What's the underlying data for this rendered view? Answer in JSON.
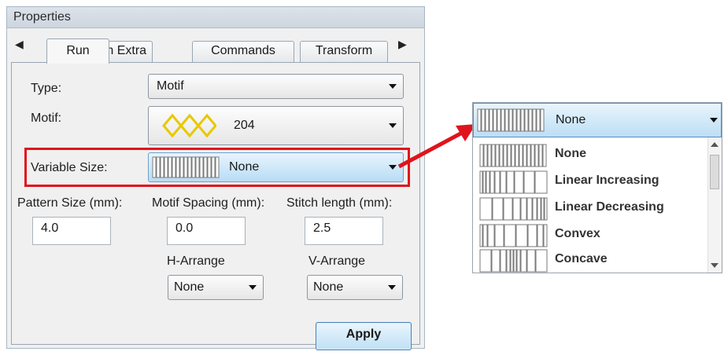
{
  "panel": {
    "title": "Properties",
    "tabs": [
      "Run",
      "Run Extra",
      "Commands",
      "Transform"
    ],
    "active_tab": "Run"
  },
  "fields": {
    "type_label": "Type:",
    "type_value": "Motif",
    "motif_label": "Motif:",
    "motif_value": "204",
    "variable_size_label": "Variable Size:",
    "variable_size_value": "None",
    "pattern_size_label": "Pattern Size (mm):",
    "pattern_size_value": "4.0",
    "motif_spacing_label": "Motif Spacing (mm):",
    "motif_spacing_value": "0.0",
    "stitch_length_label": "Stitch length (mm):",
    "stitch_length_value": "2.5",
    "h_arrange_label": "H-Arrange",
    "h_arrange_value": "None",
    "v_arrange_label": "V-Arrange",
    "v_arrange_value": "None",
    "apply_label": "Apply"
  },
  "dropdown": {
    "selected": "None",
    "options": [
      "None",
      "Linear Increasing",
      "Linear Decreasing",
      "Convex",
      "Concave"
    ]
  },
  "colors": {
    "highlight": "#e0141c",
    "motif": "#e8c800",
    "selection": "#bcdef5"
  },
  "icons": [
    "left-arrow-icon",
    "right-arrow-icon",
    "dropdown-arrow-icon",
    "motif-pattern-icon",
    "variable-size-pattern-icon",
    "callout-arrow-icon",
    "scrollbar-icon"
  ]
}
